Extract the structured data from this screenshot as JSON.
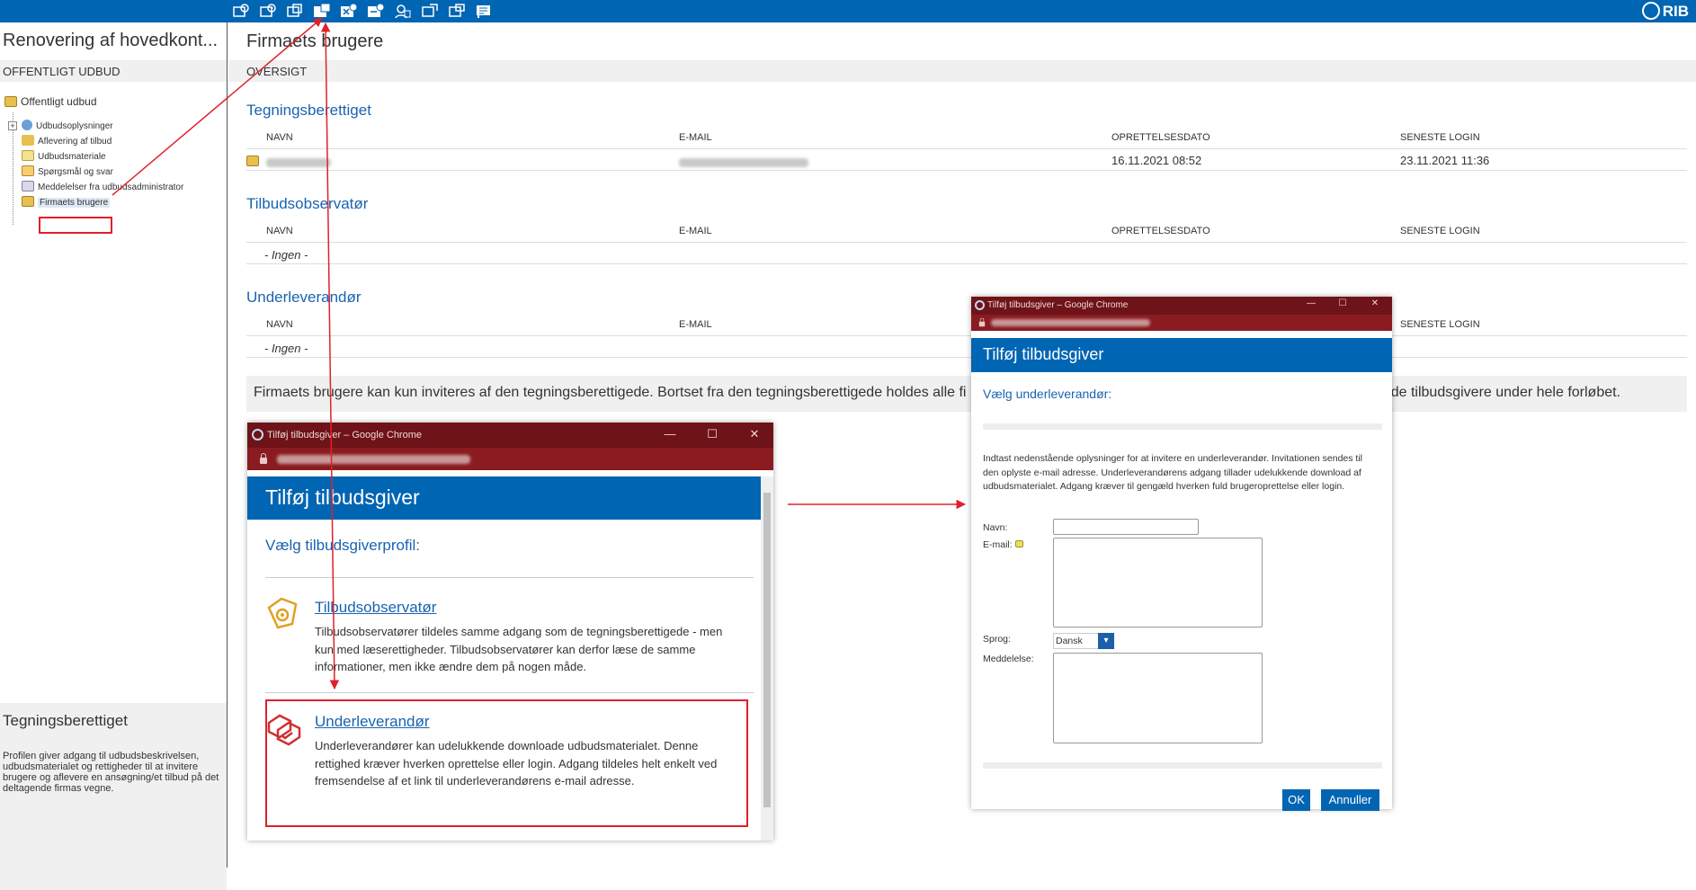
{
  "topbar": {
    "icons": [
      "toolbar-icon-1",
      "toolbar-icon-2",
      "toolbar-icon-3",
      "toolbar-icon-4",
      "toolbar-icon-5",
      "toolbar-icon-6",
      "toolbar-icon-7",
      "toolbar-icon-8",
      "toolbar-icon-9",
      "toolbar-icon-10"
    ],
    "logo": "RIB",
    "color": "#0065b3"
  },
  "left": {
    "project_title": "Renovering af hovedkont...",
    "subtitle": "OFFENTLIGT UDBUD",
    "tree": {
      "root": "Offentligt udbud",
      "items": [
        {
          "label": "Udbudsoplysninger",
          "icon": "globe-icon"
        },
        {
          "label": "Aflevering af tilbud",
          "icon": "folder-icon"
        },
        {
          "label": "Udbudsmateriale",
          "icon": "document-icon"
        },
        {
          "label": "Spørgsmål og svar",
          "icon": "question-icon"
        },
        {
          "label": "Meddelelser fra udbudsadministrator",
          "icon": "message-icon"
        },
        {
          "label": "Firmaets brugere",
          "icon": "users-icon"
        }
      ]
    },
    "bottom": {
      "title": "Tegningsberettiget",
      "text": "Profilen giver adgang til udbudsbeskrivelsen, udbudsmaterialet og rettigheder til at invitere brugere og aflevere en ansøgning/et tilbud på det deltagende firmas vegne."
    }
  },
  "main": {
    "title": "Firmaets brugere",
    "subtitle": "OVERSIGT",
    "columns": {
      "name": "NAVN",
      "email": "E-MAIL",
      "created": "OPRETTELSESDATO",
      "last_login": "SENESTE LOGIN"
    },
    "sections": [
      {
        "title": "Tegningsberettiget",
        "rows": [
          {
            "created": "16.11.2021 08:52",
            "last_login": "23.11.2021 11:36"
          }
        ]
      },
      {
        "title": "Tilbudsobservatør",
        "empty": "- Ingen -"
      },
      {
        "title": "Underleverandør",
        "empty": "- Ingen -"
      }
    ],
    "info_text_left": "Firmaets brugere kan kun inviteres af den tegningsberettigede. Bortset fra den tegningsberettigede holdes alle fi",
    "info_text_right": "de tilbudsgivere under hele forløbet."
  },
  "popup1": {
    "window_title": "Tilføj tilbudsgiver – Google Chrome",
    "heading": "Tilføj tilbudsgiver",
    "choose": "Vælg tilbudsgiverprofil:",
    "options": [
      {
        "title": "Tilbudsobservatør",
        "text": "Tilbudsobservatører tildeles samme adgang som de tegningsberettigede - men kun med læserettigheder. Tilbudsobservatører kan derfor læse de samme informationer, men ikke ændre dem på nogen måde.",
        "icon": "observer-icon"
      },
      {
        "title": "Underleverandør",
        "text": "Underleverandører kan udelukkende downloade udbudsmaterialet. Denne rettighed kræver hverken oprettelse eller login. Adgang tildeles helt enkelt ved fremsendelse af et link til underleverandørens e-mail adresse.",
        "icon": "subcontractor-icon"
      }
    ],
    "controls": {
      "minimize": "—",
      "maximize": "☐",
      "close": "✕"
    }
  },
  "popup2": {
    "window_title": "Tilføj tilbudsgiver – Google Chrome",
    "heading": "Tilføj tilbudsgiver",
    "choose": "Vælg underleverandør:",
    "text": "Indtast nedenstående oplysninger for at invitere en underleverandør. Invitationen sendes til den oplyste e-mail adresse. Underleverandørens adgang tillader udelukkende download af udbudsmaterialet. Adgang kræver til gengæld hverken fuld brugeroprettelse eller login.",
    "fields": {
      "name_label": "Navn:",
      "email_label": "E-mail:",
      "language_label": "Sprog:",
      "language_value": "Dansk",
      "message_label": "Meddelelse:"
    },
    "ok": "OK",
    "cancel": "Annuller",
    "controls": {
      "minimize": "—",
      "maximize": "☐",
      "close": "✕"
    }
  },
  "colors": {
    "accent": "#0065b3",
    "link": "#1a63b0",
    "chrome_titlebar": "#6e1318",
    "highlight": "#e0202a"
  }
}
